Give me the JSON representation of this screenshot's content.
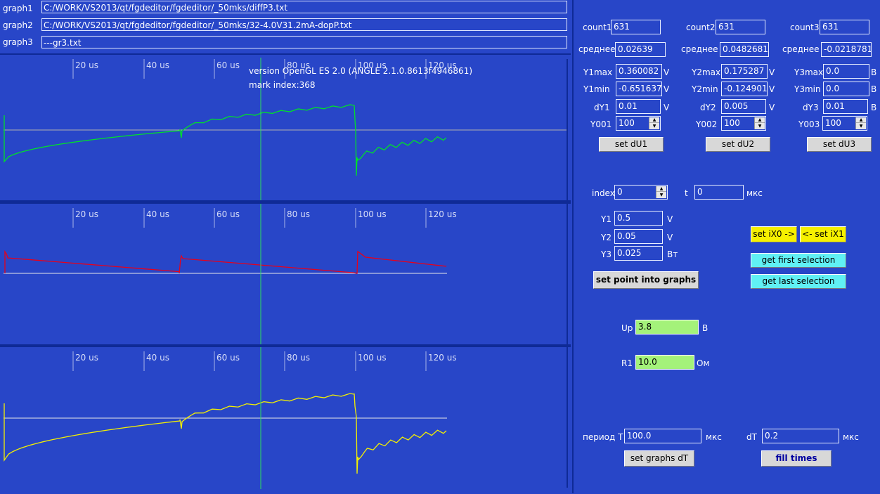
{
  "files": {
    "graph1_label": "graph1",
    "graph1_path": "C:/WORK/VS2013/qt/fgdeditor/fgdeditor/_50mks/diffP3.txt",
    "graph2_label": "graph2",
    "graph2_path": "C:/WORK/VS2013/qt/fgdeditor/fgdeditor/_50mks/32-4.0V31.2mA-dopP.txt",
    "graph3_label": "graph3",
    "graph3_path": "---gr3.txt"
  },
  "plot": {
    "version_text": "version OpenGL ES 2.0 (ANGLE 2.1.0.8613f4946861)",
    "mark_text": "mark index:368",
    "tick_labels": [
      "20 us",
      "40 us",
      "60 us",
      "80 us",
      "100 us",
      "120 us"
    ],
    "colors": {
      "graph1": "#00e02a",
      "graph2": "#e8001a",
      "graph3": "#f4f000",
      "marker": "#2ee05a",
      "baseline": "#b0b0b0"
    }
  },
  "stats": {
    "g1": {
      "count_label": "count1",
      "count": "631",
      "mean_label": "среднее",
      "mean": "0.02639",
      "max_label": "Y1max",
      "max": "0.360082",
      "max_unit": "V",
      "min_label": "Y1min",
      "min": "-0.651637",
      "min_unit": "V",
      "dy_label": "dY1",
      "dy": "0.01",
      "dy_unit": "V",
      "y0_label": "Y001",
      "y0": "100",
      "btn": "set dU1"
    },
    "g2": {
      "count_label": "count2",
      "count": "631",
      "mean_label": "среднее",
      "mean": "0.0482681",
      "max_label": "Y2max",
      "max": "0.175287",
      "max_unit": "V",
      "min_label": "Y2min",
      "min": "-0.124901",
      "min_unit": "V",
      "dy_label": "dY2",
      "dy": "0.005",
      "dy_unit": "V",
      "y0_label": "Y002",
      "y0": "100",
      "btn": "set dU2"
    },
    "g3": {
      "count_label": "count3",
      "count": "631",
      "mean_label": "среднее",
      "mean": "-0.0218781",
      "max_label": "Y3max",
      "max": "0.0",
      "max_unit": "B",
      "min_label": "Y3min",
      "min": "0.0",
      "min_unit": "B",
      "dy_label": "dY3",
      "dy": "0.01",
      "dy_unit": "B",
      "y0_label": "Y003",
      "y0": "100",
      "btn": "set dU3"
    }
  },
  "point": {
    "index_label": "index",
    "index": "0",
    "t_label": "t",
    "t": "0",
    "t_unit": "мкс",
    "y1_label": "Y1",
    "y1": "0.5",
    "y1_unit": "V",
    "y2_label": "Y2",
    "y2": "0.05",
    "y2_unit": "V",
    "y3_label": "Y3",
    "y3": "0.025",
    "y3_unit": "Вт",
    "set_point_btn": "set point into graphs",
    "set_ix0_btn": "set iX0 ->",
    "set_ix1_btn": "<- set iX1",
    "first_sel_btn": "get first selection",
    "last_sel_btn": "get last selection"
  },
  "circuit": {
    "up_label": "Up",
    "up": "3.8",
    "up_unit": "В",
    "r1_label": "R1",
    "r1": "10.0",
    "r1_unit": "Ом"
  },
  "timing": {
    "period_label": "период Т",
    "period": "100.0",
    "period_unit": "мкс",
    "dt_label": "dT",
    "dt": "0.2",
    "dt_unit": "мкс",
    "set_dt_btn": "set graphs dT",
    "fill_btn": "fill times"
  }
}
